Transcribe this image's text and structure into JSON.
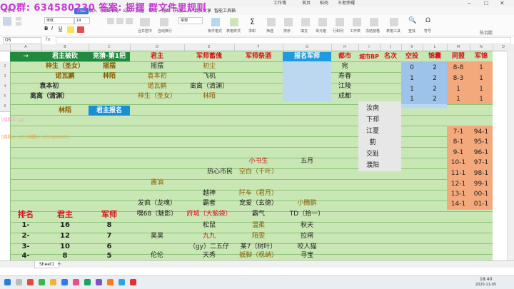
{
  "watermark": "QQ群: 634580230 答案: 摇摆 群文件里规则",
  "window_tabs": [
    "工作簿",
    "首页",
    "稻壳",
    "王者荣耀"
  ],
  "ribbon_tabs": [
    "文件",
    "开始",
    "插入",
    "页面布局",
    "公式",
    "数据",
    "审阅",
    "视图",
    "开发工具",
    "会员专享",
    "智能工具箱"
  ],
  "active_ribbon_tab": "开始",
  "toolbar": {
    "font_name": "宋体",
    "font_size": "14",
    "labels": [
      "合并居中",
      "自动换行",
      "常规",
      "条件格式",
      "表格样式",
      "求和",
      "筛选",
      "排序",
      "填充",
      "单元格",
      "行和列",
      "工作表",
      "冻结窗格",
      "表格工具",
      "查找",
      "符号"
    ]
  },
  "formula_bar": {
    "cell_ref": "O5"
  },
  "right_brand": "陈羽鹏",
  "columns": [
    "A",
    "B",
    "C",
    "D",
    "E",
    "F",
    "G",
    "H",
    "I",
    "J",
    "K",
    "L",
    "M",
    "N",
    "O",
    "P",
    "Q",
    "R"
  ],
  "headers": {
    "h1": "→",
    "h2": "君主被砍",
    "h3": "竞猜-第1把",
    "h4": "君主",
    "h5": "军师蓄傀",
    "h6": "军师祭酒",
    "h7": "报名军师",
    "h8": "都市",
    "h9": "城市BP",
    "h10": "名次",
    "h11": "空投",
    "h12": "锦囊",
    "h13": "同盟",
    "h14": "军锦"
  },
  "left_block": {
    "r1": [
      "梓生（圣女）",
      "摇摆"
    ],
    "r2": [
      "诺瓦鹂",
      "林陌"
    ],
    "r3": [
      "袁本初"
    ],
    "r4": [
      "离离（清渊）"
    ],
    "r5": [
      "林陌"
    ],
    "signup": "君主报名"
  },
  "center_block": {
    "c_jun": [
      "摇摆",
      "袁本初",
      "诺瓦鹂",
      "梓生（圣女）"
    ],
    "c_xukui": [
      "初尘",
      "飞机",
      "离离（清渊）",
      "林陌"
    ]
  },
  "cities": [
    "宛",
    "寿春",
    "江陵",
    "成都"
  ],
  "cities_more": [
    "汝南",
    "下邳",
    "江夏",
    "蓟",
    "交趾",
    "濮阳"
  ],
  "stats_top": [
    [
      "0",
      "2",
      "8-8",
      "1"
    ],
    [
      "1",
      "2",
      "8-3",
      "1"
    ],
    [
      "1",
      "2",
      "1",
      "1"
    ],
    [
      "1",
      "2",
      "1",
      "1"
    ]
  ],
  "stats_bottom": [
    [
      "7-1",
      "94-1"
    ],
    [
      "8-1",
      "95-1"
    ],
    [
      "9-1",
      "96-1"
    ],
    [
      "10-1",
      "97-1"
    ],
    [
      "11-1",
      "98-1"
    ],
    [
      "12-1",
      "99-1"
    ],
    [
      "13-1",
      "00-1"
    ],
    [
      "14-1",
      "01-1"
    ]
  ],
  "chat": [
    "[摇摆人 12]",
    "[摇摆人 12] [摇摆人 12] [0/0/0/0]"
  ],
  "middle_names": {
    "xiaoshusheng": "小书生",
    "wuyue": "五月",
    "rexin": "热心市民",
    "kongbai": "空白（千叶）",
    "jiangyou": "酱油",
    "yuexi": "越神",
    "qianchen": "阡车（君月）",
    "fafeng": "发疯（龙魂）",
    "bazhe": "霸者",
    "chongai": "宠爱（玄德）",
    "xiaotengpeng": "小腾鹏"
  },
  "rank_table": {
    "headers": [
      "排名",
      "君主",
      "军师"
    ],
    "rows": [
      [
        "1-",
        "16",
        "8"
      ],
      [
        "2-",
        "12",
        "7"
      ],
      [
        "3-",
        "10",
        "6"
      ],
      [
        "4-",
        "8",
        "5"
      ]
    ]
  },
  "bottom_names": {
    "row0": [
      "嘿68（魅影）",
      "府城（大脑袋）",
      "霸气",
      "TD（拾一）"
    ],
    "row1": [
      "松鼠",
      "温柔",
      "秋天"
    ],
    "row2": [
      "昊昊",
      "九九",
      "陌雯",
      "拉闸"
    ],
    "row3": [
      "（gy）二五仔",
      "某7（树叶）",
      "咬人猫"
    ],
    "row4": [
      "伦伦",
      "天秀",
      "扳脚（枧峭）",
      "寻宝"
    ]
  },
  "sheet_tab": "Sheet1",
  "clock": {
    "time": "18:40",
    "date": "2020-11-05"
  },
  "colors": {
    "accent": "#2b7bd8",
    "light_green": "#c9e7b4",
    "dark_green": "#218a3f",
    "blue": "#9ec3ea",
    "orange": "#f4a97c"
  }
}
